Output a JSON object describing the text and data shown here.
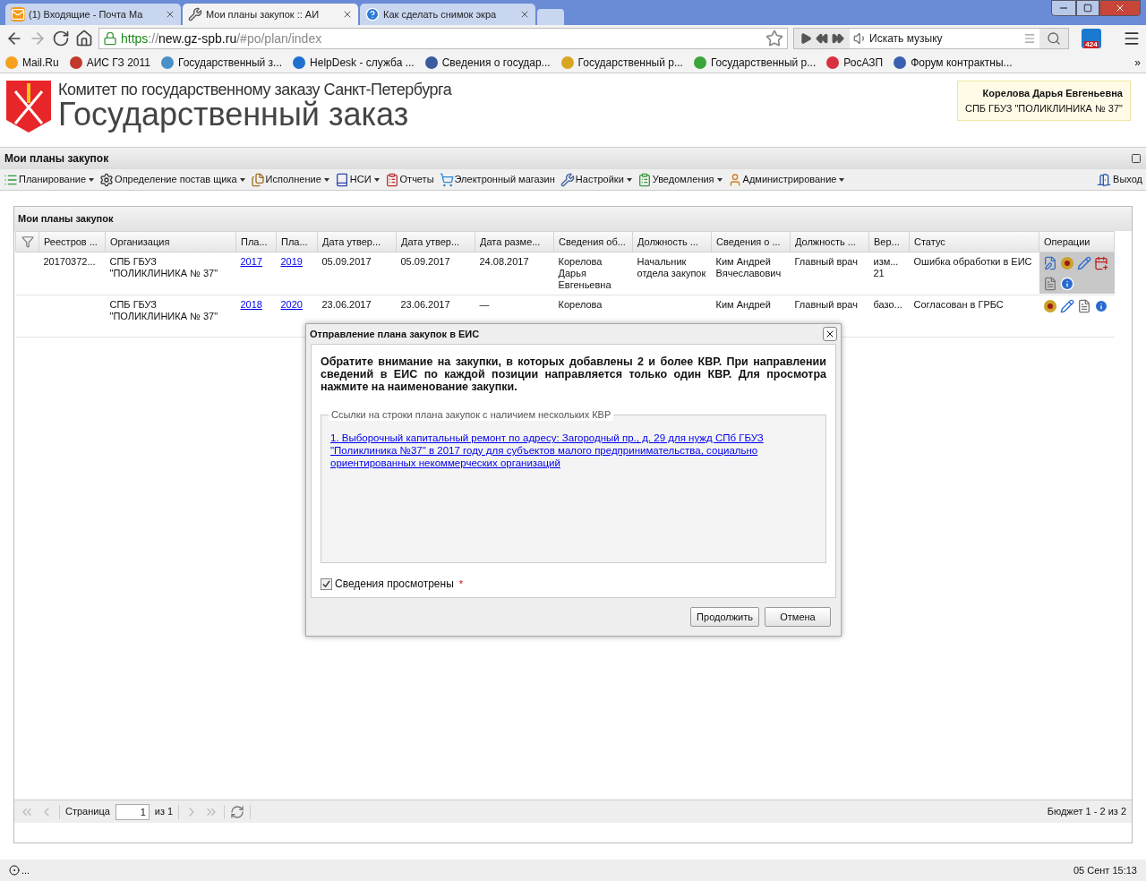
{
  "browser": {
    "tabs": [
      {
        "title": "(1) Входящие - Почта Ма",
        "kind": "mail",
        "selected": false
      },
      {
        "title": "Мои планы закупок :: АИ",
        "kind": "tools",
        "selected": true
      },
      {
        "title": "Как сделать снимок экра",
        "kind": "help",
        "selected": false
      }
    ],
    "address": {
      "scheme": "https",
      "sep": "://",
      "host": "new.gz-spb.ru",
      "path": "/#po/plan/index"
    },
    "music_placeholder": "Искать музыку",
    "badge": "424",
    "bookmarks": [
      {
        "label": "Mail.Ru",
        "color": "#f7a01c"
      },
      {
        "label": "АИС ГЗ 2011",
        "color": "#c0392b"
      },
      {
        "label": "Государственный з...",
        "color": "#4a90c8"
      },
      {
        "label": "HelpDesk - служба ...",
        "color": "#1e6fd0"
      },
      {
        "label": "Сведения о государ...",
        "color": "#3b5ba0"
      },
      {
        "label": "Государственный р...",
        "color": "#d9a520"
      },
      {
        "label": "Государственный р...",
        "color": "#3aa53a"
      },
      {
        "label": "РосАЗП",
        "color": "#d93040"
      },
      {
        "label": "Форум контрактны...",
        "color": "#3a5fb0"
      }
    ],
    "bookmarks_more": "»"
  },
  "header": {
    "committee": "Комитет по государственному заказу Санкт-Петербурга",
    "title": "Государственный заказ",
    "user_name": "Корелова Дарья Евгеньевна",
    "user_org": "СПБ ГБУЗ \"ПОЛИКЛИНИКА № 37\""
  },
  "panel_title": "Мои планы закупок",
  "menu": [
    {
      "label": "Планирование",
      "kind": "list",
      "dropdown": true
    },
    {
      "label": "Определение постав щика",
      "kind": "gears",
      "dropdown": true
    },
    {
      "label": "Исполнение",
      "kind": "docs",
      "dropdown": true
    },
    {
      "label": "НСИ",
      "kind": "book",
      "dropdown": true
    },
    {
      "label": "Отчеты",
      "kind": "report",
      "dropdown": false
    },
    {
      "label": "Электронный магазин",
      "kind": "cart",
      "dropdown": false
    },
    {
      "label": "Настройки",
      "kind": "wrench",
      "dropdown": true
    },
    {
      "label": "Уведомления",
      "kind": "note",
      "dropdown": true
    },
    {
      "label": "Администрирование",
      "kind": "user",
      "dropdown": true
    }
  ],
  "logout": "Выход",
  "grid": {
    "title": "Мои планы закупок",
    "columns": [
      "Реестров ...",
      "Организация",
      "Пла...",
      "Пла...",
      "Дата утвер...",
      "Дата утвер...",
      "Дата разме...",
      "Сведения об...",
      "Должность ...",
      "Сведения о ...",
      "Должность ...",
      "Вер...",
      "Статус",
      "Операции"
    ],
    "rows": [
      {
        "selected": true,
        "cells": [
          "20170372...",
          "СПБ ГБУЗ \"ПОЛИКЛИНИКА № 37\"",
          "2017",
          "2019",
          "05.09.2017",
          "05.09.2017",
          "24.08.2017",
          "Корелова Дарья Евгеньевна",
          "Начальник отдела закупок",
          "Ким Андрей Вячеславович",
          "Главный врач",
          "изм... 21",
          "Ошибка обработки в ЕИС"
        ],
        "operations": [
          {
            "kind": "edit"
          },
          {
            "kind": "emblem"
          },
          {
            "kind": "pencil"
          },
          {
            "kind": "calendar"
          },
          {
            "kind": "doc"
          },
          {
            "kind": "info"
          }
        ]
      },
      {
        "selected": false,
        "cells": [
          "",
          "СПБ ГБУЗ \"ПОЛИКЛИНИКА № 37\"",
          "2018",
          "2020",
          "23.06.2017",
          "23.06.2017",
          "—",
          "Корелова",
          "",
          "Ким Андрей",
          "Главный врач",
          "базо...",
          "Согласован в ГРБС"
        ],
        "operations": [
          {
            "kind": "emblem"
          },
          {
            "kind": "pencil"
          },
          {
            "kind": "doc"
          },
          {
            "kind": "info"
          }
        ]
      }
    ]
  },
  "paging": {
    "page_label": "Страница",
    "page": "1",
    "of": "из 1",
    "summary": "Бюджет 1 - 2 из 2"
  },
  "dialog": {
    "title": "Отправление плана закупок в ЕИС",
    "message": "Обратите внимание на закупки, в которых добавлены 2 и более КВР. При направлении сведений в ЕИС по каждой позиции направляется только один КВР. Для просмотра нажмите на наименование закупки.",
    "legend": "Ссылки на строки плана закупок с наличием нескольких КВР",
    "links": [
      "1. Выборочный капитальный ремонт по адресу: Загородный пр., д. 29 для нужд СПб ГБУЗ \"Поликлиника №37\" в 2017 году для субъектов малого предпринимательства, социально ориентированных некоммерческих организаций"
    ],
    "checkbox": {
      "label": "Сведения просмотрены",
      "checked": true,
      "required": "*"
    },
    "buttons": [
      "Продолжить",
      "Отмена"
    ]
  },
  "status_bar": {
    "left": "...",
    "right": "05 Сент 15:13"
  }
}
